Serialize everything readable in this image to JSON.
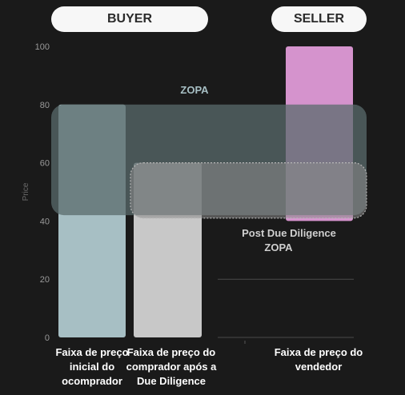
{
  "header": {
    "buyer_label": "BUYER",
    "seller_label": "SELLER"
  },
  "chart_data": {
    "type": "bar",
    "ylabel": "Price",
    "ylim": [
      0,
      100
    ],
    "yticks": [
      0,
      20,
      40,
      60,
      80,
      100
    ],
    "categories": [
      "Faixa de preço inicial do ocomprador",
      "Faixa de preço do comprador após a Due Diligence",
      "Faixa de preço do vendedor"
    ],
    "bars": [
      {
        "low": 0,
        "high": 80,
        "color": "#a7bfc4"
      },
      {
        "low": 0,
        "high": 60,
        "color": "#c8c8c8"
      },
      {
        "low": 40,
        "high": 100,
        "color": "#d593cd"
      }
    ],
    "zones": [
      {
        "label": "ZOPA",
        "low": 42,
        "high": 80
      },
      {
        "label": "Post Due Diligence ZOPA",
        "low": 41,
        "high": 60
      }
    ],
    "colors": {
      "background": "#1a1a1a",
      "zopa_overlay": "#5a6b6c",
      "post_zopa_overlay": "#8a8a8a",
      "zopa_text": "#a7bfc4",
      "annotation_text": "#cfcfcf"
    }
  }
}
